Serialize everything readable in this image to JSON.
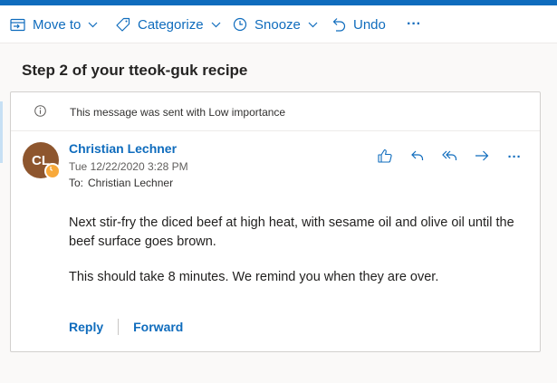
{
  "toolbar": {
    "move_to": "Move to",
    "categorize": "Categorize",
    "snooze": "Snooze",
    "undo": "Undo",
    "more": "···"
  },
  "message": {
    "subject": "Step 2 of your tteok-guk recipe",
    "importance_notice": "This message was sent with Low importance",
    "avatar_initials": "CL",
    "sender": "Christian Lechner",
    "date": "Tue 12/22/2020 3:28 PM",
    "to_label": "To:",
    "to_name": "Christian Lechner",
    "body": [
      "Next stir-fry the diced beef at high heat, with sesame oil and olive oil until the beef surface goes brown.",
      "This should take 8 minutes. We remind you when they are over."
    ],
    "more_label": "···"
  },
  "footer": {
    "reply": "Reply",
    "forward": "Forward"
  },
  "colors": {
    "accent": "#0f6cbd",
    "avatar": "#8e562e",
    "presence": "#f8a93a"
  },
  "icons": [
    "move-to-icon",
    "tag-icon",
    "clock-icon",
    "undo-icon",
    "like-icon",
    "reply-icon",
    "reply-all-icon",
    "forward-icon"
  ]
}
